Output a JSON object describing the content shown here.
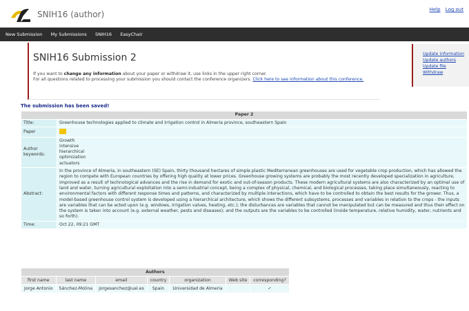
{
  "app": {
    "title": "SNIH16 (author)"
  },
  "toplinks": {
    "help": "Help",
    "logout": "Log out"
  },
  "menu": [
    "New Submission",
    "My Submissions",
    "SNIH16",
    "EasyChair"
  ],
  "page": {
    "title": "SNIH16 Submission 2",
    "intro_line1_a": "If you want to ",
    "intro_line1_b": "change any information",
    "intro_line1_c": " about your paper or withdraw it, use links in the upper right corner.",
    "intro_line2": "For all questions related to processing your submission you should contact the conference organizers. ",
    "intro_link": "Click here to see information about this conference."
  },
  "side_links": [
    "Update information",
    "Update authors",
    "Update file",
    "Withdraw"
  ],
  "saved_message": "The submission has been saved!",
  "paper": {
    "header": "Paper 2",
    "title_label": "Title:",
    "title": "Greenhouse technologies applied to climate and irrigation control in Almeria province, southeastern Spain",
    "paper_label": "Paper",
    "keywords_label": "Author keywords:",
    "keywords": [
      "Growth",
      "intensive",
      "hierarchical",
      "optimization",
      "actuators"
    ],
    "abstract_label": "Abstract:",
    "abstract": "In the province of Almeria, in southeastern (SE) Spain, thirty thousand hectares of simple plastic Mediterranean greenhouses are used for vegetable crop production, which has allowed the region to compete with European countries by offering high quality at lower prices. Greenhouse growing systems are probably the most recently developed specialization in agriculture, improved as a result of technological advances and the rise in demand for exotic and out-of-season products. These modern agricultural systems are also characterized by an optimal use of land and water, turning agricultural exploitation into a semi-industrial concept, being a complex of physical, chemical, and biological processes, taking place simultaneously, reacting to environmental factors with different response times and patterns, and characterized by multiple interactions, which have to be controlled to obtain the best results for the grower. Thus, a model-based greenhouse control system is developed using a hierarchical architecture, which shows the different subsystems, processes and variables in relation to the crops - the inputs are variables that can be acted upon (e.g. windows, irrigation valves, heating, etc.); the disturbances are variables that cannot be manipulated but can be measured and thus their effect on the system is taken into account (e.g. external weather, pests and diseases); and the outputs are the variables to be controlled (inside temperature, relative humidity, water, nutrients and so forth).",
    "time_label": "Time:",
    "time": "Oct 22, 09:21 GMT"
  },
  "authors": {
    "header": "Authors",
    "columns": [
      "first name",
      "last name",
      "email",
      "country",
      "organization",
      "Web site",
      "corresponding?"
    ],
    "rows": [
      [
        "Jorge Antonio",
        "Sánchez-Molina",
        "jorgesanchez@ual.es",
        "Spain",
        "Universidad de Almeria",
        "",
        "✓"
      ]
    ]
  }
}
